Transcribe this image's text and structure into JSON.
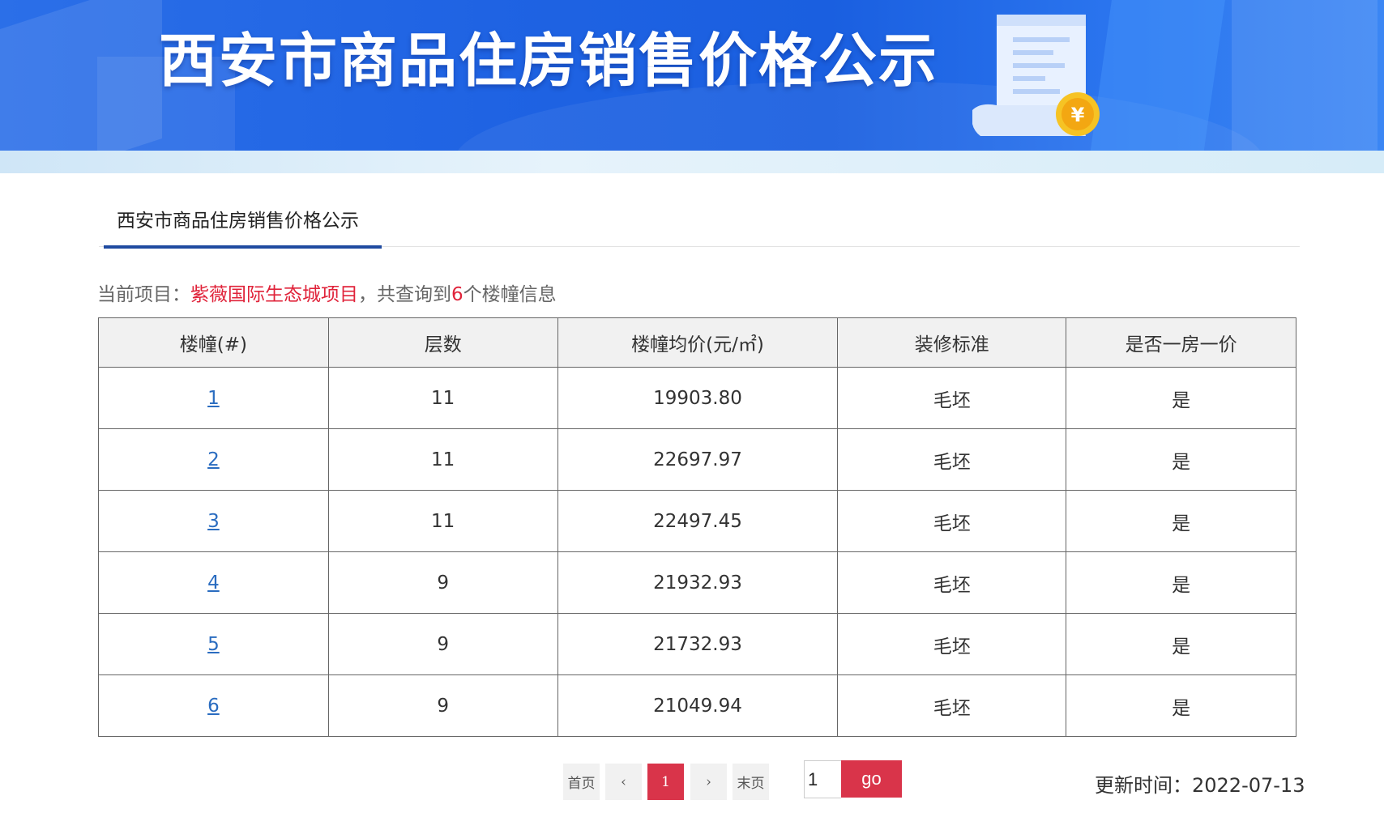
{
  "banner": {
    "title": "西安市商品住房销售价格公示",
    "coin_symbol": "¥"
  },
  "tab": {
    "title": "西安市商品住房销售价格公示"
  },
  "info": {
    "prefix": "当前项目：",
    "project_name": "紫薇国际生态城项目",
    "middle": "，共查询到",
    "count": "6",
    "suffix": "个楼幢信息"
  },
  "table": {
    "headers": [
      "楼幢(#)",
      "层数",
      "楼幢均价(元/㎡)",
      "装修标准",
      "是否一房一价"
    ],
    "rows": [
      {
        "building": "1",
        "floors": "11",
        "avg_price": "19903.80",
        "decoration": "毛坯",
        "one_price": "是"
      },
      {
        "building": "2",
        "floors": "11",
        "avg_price": "22697.97",
        "decoration": "毛坯",
        "one_price": "是"
      },
      {
        "building": "3",
        "floors": "11",
        "avg_price": "22497.45",
        "decoration": "毛坯",
        "one_price": "是"
      },
      {
        "building": "4",
        "floors": "9",
        "avg_price": "21932.93",
        "decoration": "毛坯",
        "one_price": "是"
      },
      {
        "building": "5",
        "floors": "9",
        "avg_price": "21732.93",
        "decoration": "毛坯",
        "one_price": "是"
      },
      {
        "building": "6",
        "floors": "9",
        "avg_price": "21049.94",
        "decoration": "毛坯",
        "one_price": "是"
      }
    ]
  },
  "pagination": {
    "first": "首页",
    "prev": "‹",
    "current": "1",
    "next": "›",
    "last": "末页",
    "input_value": "1",
    "go": "go"
  },
  "update": {
    "text": "更新时间：2022-07-13"
  },
  "colors": {
    "accent_red": "#d9344a",
    "tab_underline": "#1f4aa0",
    "link_blue": "#2a6cc0",
    "banner_blue": "#1f63e3"
  }
}
